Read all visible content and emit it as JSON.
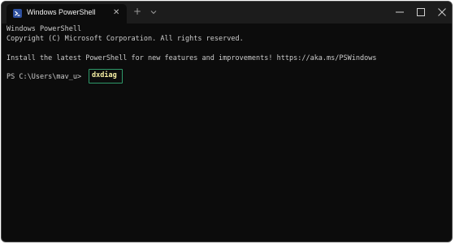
{
  "window": {
    "tab_title": "Windows PowerShell",
    "tab_icon": "powershell-icon",
    "close_tab_glyph": "✕",
    "new_tab_glyph": "+",
    "colors": {
      "terminal_bg": "#0c0c0c",
      "titlebar_bg": "#1c1c1c",
      "text": "#cccccc",
      "command_text": "#f9f1a5",
      "highlight_border": "#2f9a6a"
    }
  },
  "terminal": {
    "lines": [
      "Windows PowerShell",
      "Copyright (C) Microsoft Corporation. All rights reserved.",
      "Install the latest PowerShell for new features and improvements! https://aka.ms/PSWindows"
    ],
    "prompt": "PS C:\\Users\\mav_u>",
    "command": "dxdiag"
  }
}
